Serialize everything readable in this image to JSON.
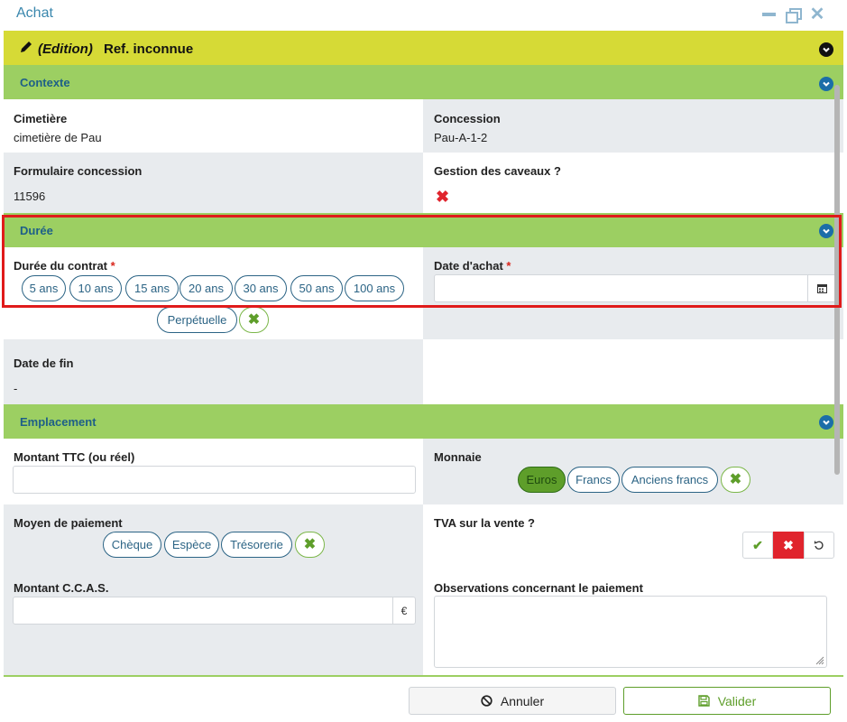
{
  "window": {
    "title": "Achat"
  },
  "header": {
    "edition": "(Edition)",
    "reference": "Ref. inconnue"
  },
  "sections": {
    "contexte": "Contexte",
    "duree": "Durée",
    "emplacement": "Emplacement"
  },
  "contexte": {
    "cimetiere_label": "Cimetière",
    "cimetiere_value": "cimetière de Pau",
    "concession_label": "Concession",
    "concession_value": "Pau-A-1-2",
    "formulaire_label": "Formulaire concession",
    "formulaire_value": "11596",
    "caveaux_label": "Gestion des caveaux ?"
  },
  "duree": {
    "contrat_label": "Durée du contrat",
    "required_mark": "*",
    "options": [
      "5 ans",
      "10 ans",
      "15 ans",
      "20 ans",
      "30 ans",
      "50 ans",
      "100 ans",
      "Perpétuelle"
    ],
    "date_achat_label": "Date d'achat",
    "date_achat_value": "",
    "date_fin_label": "Date de fin",
    "date_fin_value": "-"
  },
  "emplacement": {
    "montant_ttc_label": "Montant TTC (ou réel)",
    "montant_ttc_value": "",
    "monnaie_label": "Monnaie",
    "monnaie_options": [
      "Euros",
      "Francs",
      "Anciens francs"
    ],
    "monnaie_selected": "Euros",
    "moyen_label": "Moyen de paiement",
    "moyen_options": [
      "Chèque",
      "Espèce",
      "Trésorerie"
    ],
    "tva_label": "TVA sur la vente ?",
    "ccas_label": "Montant C.C.A.S.",
    "ccas_value": "",
    "currency_symbol": "€",
    "observations_label": "Observations concernant le paiement",
    "observations_value": ""
  },
  "footer": {
    "cancel_label": "Annuler",
    "ok_label": "Valider"
  },
  "icons": {
    "calendar": "calendar-icon",
    "pencil": "pencil-icon",
    "chevron": "chevron-down-icon",
    "clear": "clear-x-icon",
    "ban": "ban-icon",
    "save": "floppy-disk-icon"
  },
  "colors": {
    "accent_green": "#9ccf62",
    "header_yellow": "#d6da36",
    "link_blue": "#2c6485",
    "danger_red": "#e0242d",
    "highlight_red": "#e01b1b"
  }
}
